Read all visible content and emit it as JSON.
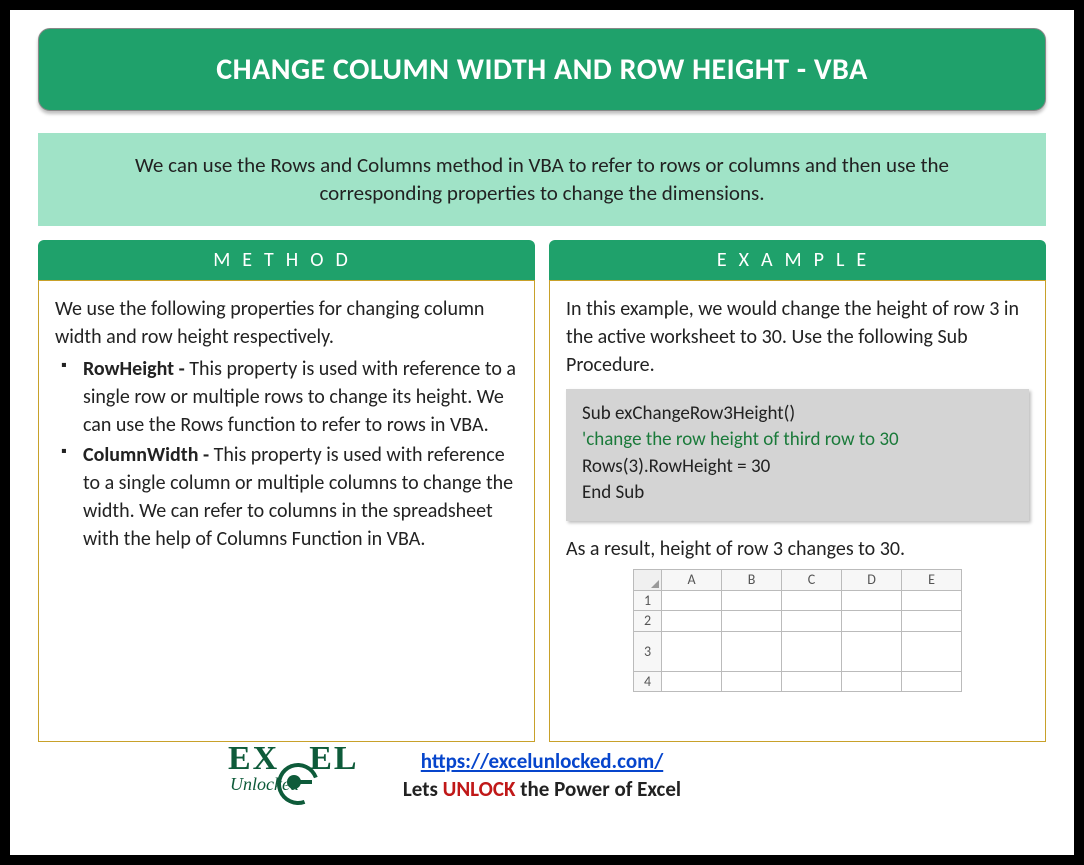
{
  "title": "CHANGE COLUMN WIDTH AND ROW HEIGHT - VBA",
  "intro": "We can use the Rows and Columns method in VBA to refer to rows or columns and then use the corresponding properties to change the dimensions.",
  "method": {
    "header": "METHOD",
    "lead": "We use the following properties for changing column width and row height respectively.",
    "items": [
      {
        "name": "RowHeight - ",
        "desc": "This property is used with reference to a single row or multiple rows to change its height. We can use the Rows function to refer to rows in VBA."
      },
      {
        "name": "ColumnWidth - ",
        "desc": "This property is used with reference to a single column or multiple columns to change the width. We can refer to columns in the spreadsheet with the help of Columns Function in VBA."
      }
    ]
  },
  "example": {
    "header": "EXAMPLE",
    "lead": "In this example, we would change the height of row 3 in the active worksheet to 30. Use the following Sub Procedure.",
    "code": {
      "l1": "Sub exChangeRow3Height()",
      "l2": "'change the row height of third row to 30",
      "l3": "Rows(3).RowHeight = 30",
      "l4": "End Sub"
    },
    "result": "As a result, height of row 3 changes to 30.",
    "grid": {
      "cols": [
        "A",
        "B",
        "C",
        "D",
        "E"
      ],
      "rows": [
        "1",
        "2",
        "3",
        "4"
      ],
      "tall_row": "3"
    }
  },
  "footer": {
    "url": "https://excelunlocked.com/",
    "tag_pre": "Lets ",
    "tag_unlock": "UNLOCK",
    "tag_post": " the Power of Excel",
    "logo_main_pre": "EX",
    "logo_main_post": "EL",
    "logo_sub": "Unlocked"
  }
}
